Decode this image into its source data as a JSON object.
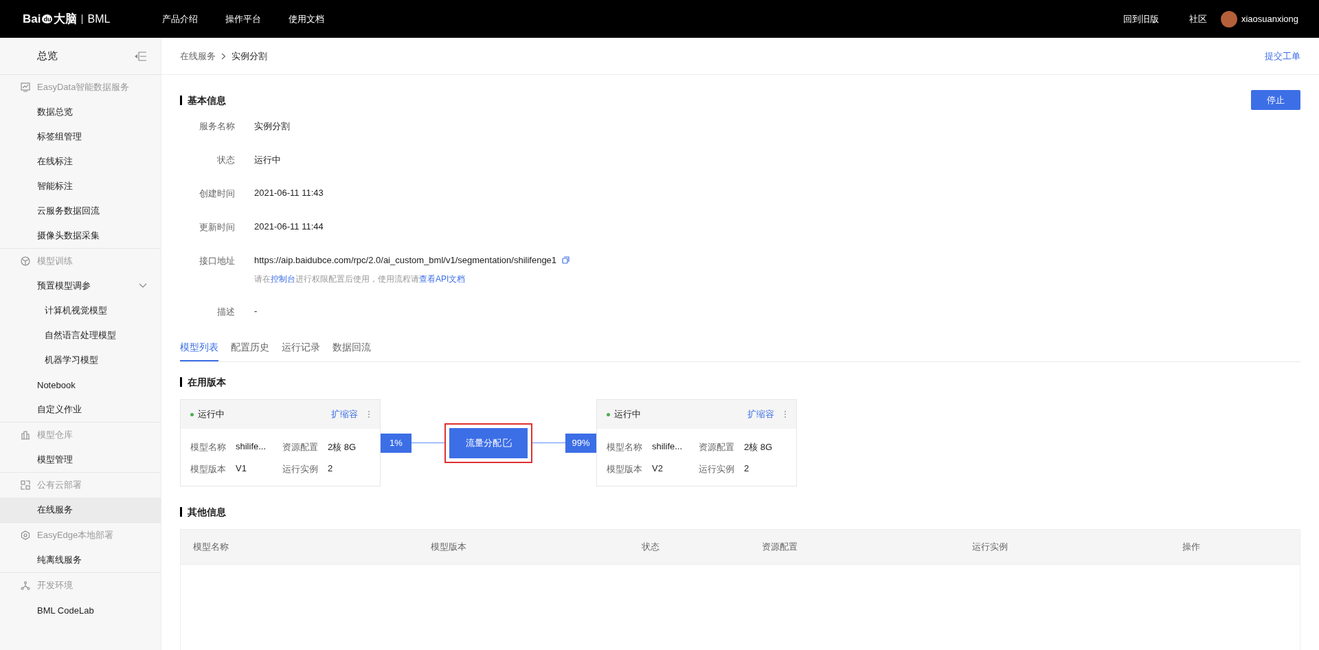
{
  "topbar": {
    "logo": {
      "brand": "Bai",
      "mark": "du",
      "suffix": "大脑",
      "product": "BML"
    },
    "nav": [
      {
        "label": "产品介绍",
        "selected": false
      },
      {
        "label": "操作平台",
        "selected": false
      },
      {
        "label": "使用文档",
        "selected": false
      }
    ],
    "links": [
      "回到旧版",
      "社区"
    ],
    "user": {
      "name": "xiaosuanxiong"
    }
  },
  "sidebar": {
    "overview": "总览",
    "groups": [
      {
        "title": "EasyData智能数据服务",
        "items": [
          {
            "label": "数据总览",
            "selected": false
          },
          {
            "label": "标签组管理",
            "selected": false
          },
          {
            "label": "在线标注",
            "selected": false
          },
          {
            "label": "智能标注",
            "selected": false
          },
          {
            "label": "云服务数据回流",
            "selected": false
          },
          {
            "label": "摄像头数据采集",
            "selected": false
          }
        ]
      },
      {
        "title": "模型训练",
        "items": [
          {
            "label": "预置模型调参",
            "selected": false,
            "expanded": true,
            "children": [
              {
                "label": "计算机视觉模型",
                "selected": false
              },
              {
                "label": "自然语言处理模型",
                "selected": false
              },
              {
                "label": "机器学习模型",
                "selected": false
              }
            ]
          },
          {
            "label": "Notebook",
            "selected": false
          },
          {
            "label": "自定义作业",
            "selected": false
          }
        ]
      },
      {
        "title": "模型仓库",
        "items": [
          {
            "label": "模型管理",
            "selected": false
          }
        ]
      },
      {
        "title": "公有云部署",
        "items": [
          {
            "label": "在线服务",
            "selected": true
          }
        ]
      },
      {
        "title": "EasyEdge本地部署",
        "items": [
          {
            "label": "纯离线服务",
            "selected": false
          }
        ]
      },
      {
        "title": "开发环境",
        "items": [
          {
            "label": "BML CodeLab",
            "selected": false
          }
        ]
      }
    ]
  },
  "breadcrumb": {
    "items": [
      "在线服务",
      "实例分割"
    ],
    "action": "提交工单"
  },
  "basic_info": {
    "title": "基本信息",
    "button": "停止",
    "fields": [
      {
        "kind": "text",
        "label": "服务名称",
        "value": "实例分割"
      },
      {
        "kind": "text",
        "label": "状态",
        "value": "运行中"
      },
      {
        "kind": "text",
        "label": "创建时间",
        "value": "2021-06-11 11:43"
      },
      {
        "kind": "text",
        "label": "更新时间",
        "value": "2021-06-11 11:44"
      },
      {
        "kind": "url",
        "label": "接口地址",
        "value": "https://aip.baidubce.com/rpc/2.0/ai_custom_bml/v1/segmentation/shilifenge1",
        "note": [
          {
            "text": "请在",
            "link": false
          },
          {
            "text": "控制台",
            "link": true
          },
          {
            "text": "进行权限配置后使用，使用流程请",
            "link": false
          },
          {
            "text": "查看API文档",
            "link": true
          }
        ]
      },
      {
        "kind": "text",
        "label": "描述",
        "value": "-"
      }
    ]
  },
  "tabs": [
    {
      "label": "模型列表",
      "selected": true
    },
    {
      "label": "配置历史",
      "selected": false
    },
    {
      "label": "运行记录",
      "selected": false
    },
    {
      "label": "数据回流",
      "selected": false
    }
  ],
  "in_use": {
    "title": "在用版本",
    "versions": [
      {
        "status": "运行中",
        "action": "扩缩容",
        "share": "1%",
        "fields": [
          {
            "label": "模型名称",
            "value": "shilife..."
          },
          {
            "label": "资源配置",
            "value": "2核 8G"
          },
          {
            "label": "模型版本",
            "value": "V1"
          },
          {
            "label": "运行实例",
            "value": "2"
          }
        ]
      },
      {
        "status": "运行中",
        "action": "扩缩容",
        "share": "99%",
        "fields": [
          {
            "label": "模型名称",
            "value": "shilife..."
          },
          {
            "label": "资源配置",
            "value": "2核 8G"
          },
          {
            "label": "模型版本",
            "value": "V2"
          },
          {
            "label": "运行实例",
            "value": "2"
          }
        ]
      }
    ],
    "traffic_button": {
      "label": "流量分配",
      "highlighted": true
    }
  },
  "other_info": {
    "title": "其他信息",
    "columns": [
      "模型名称",
      "模型版本",
      "状态",
      "资源配置",
      "运行实例",
      "操作"
    ]
  }
}
